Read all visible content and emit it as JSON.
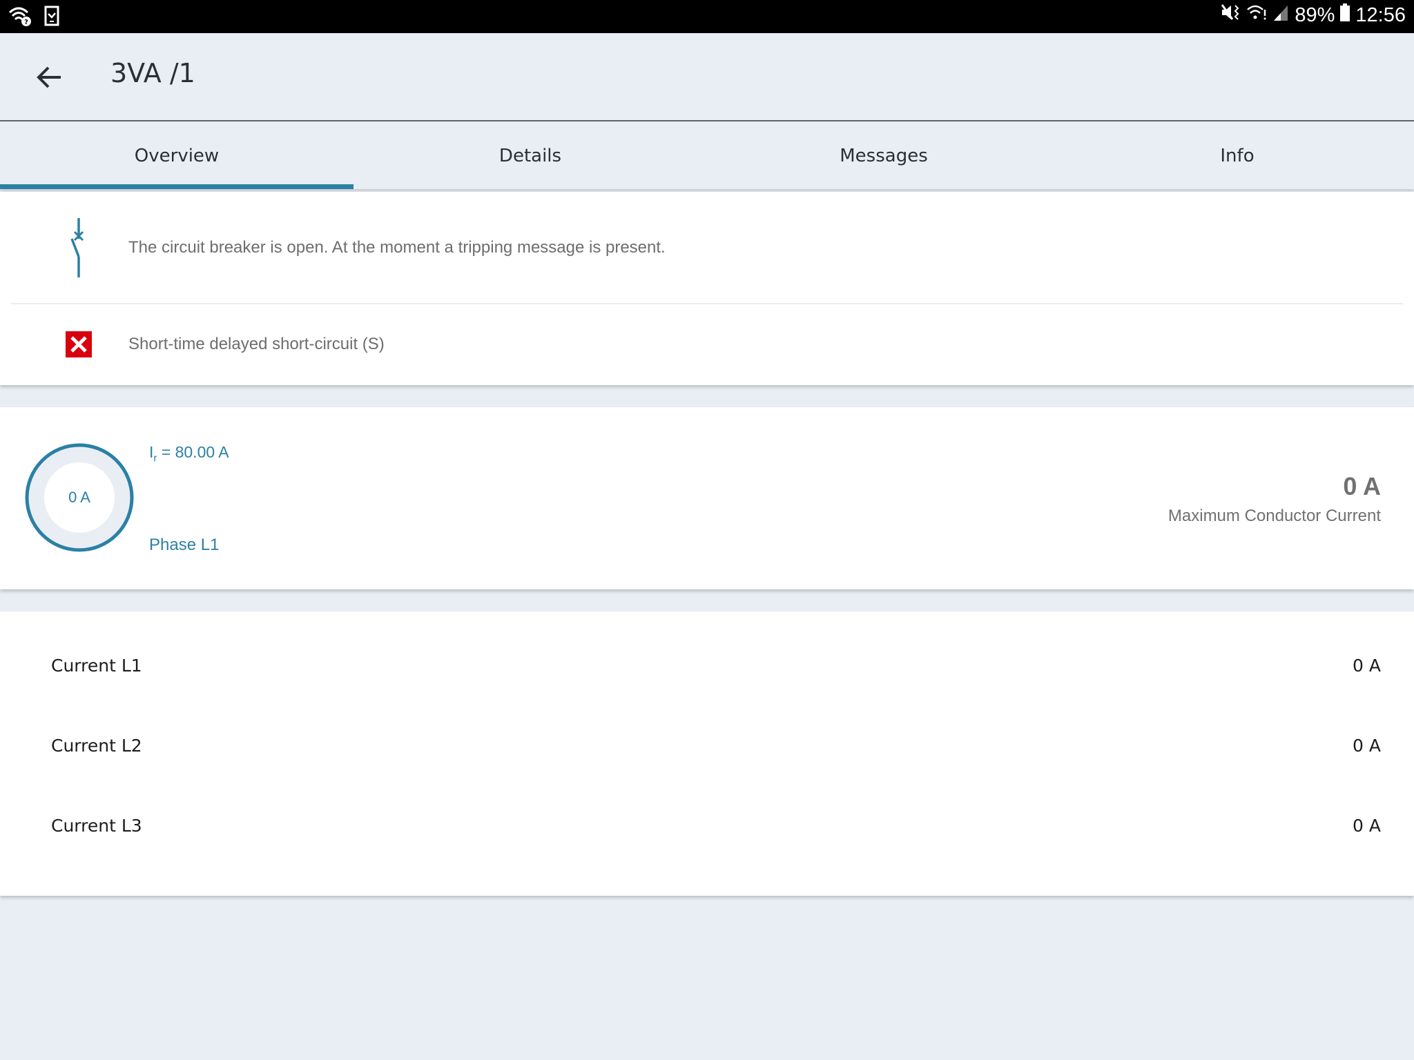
{
  "status_bar": {
    "left_icons": [
      "wifi-question-icon",
      "device-check-icon"
    ],
    "right_icons": [
      "mute-vibrate-icon",
      "wifi-alert-icon",
      "signal-icon",
      "battery-icon"
    ],
    "battery": "89%",
    "time": "12:56"
  },
  "app_bar": {
    "back_icon": "arrow-back-icon",
    "title": "3VA /1"
  },
  "tabs": [
    {
      "label": "Overview",
      "active": true
    },
    {
      "label": "Details",
      "active": false
    },
    {
      "label": "Messages",
      "active": false
    },
    {
      "label": "Info",
      "active": false
    }
  ],
  "status_card": {
    "items": [
      {
        "icon": "breaker-open-icon",
        "text": "The circuit breaker is open. At the moment a tripping message is present."
      },
      {
        "icon": "error-x-icon",
        "text": "Short-time delayed short-circuit (S)"
      }
    ]
  },
  "gauge_card": {
    "gauge_value": "0 A",
    "gauge_fraction": 0,
    "ir_label": "I",
    "ir_sub": "r",
    "ir_value": " = 80.00 A",
    "phase": "Phase L1",
    "max_value": "0 A",
    "max_label": "Maximum Conductor Current"
  },
  "currents": [
    {
      "label": "Current L1",
      "value": "0 A"
    },
    {
      "label": "Current L2",
      "value": "0 A"
    },
    {
      "label": "Current L3",
      "value": "0 A"
    }
  ],
  "colors": {
    "accent": "#2b80a5",
    "error": "#d9000d",
    "background": "#e9eef5"
  }
}
